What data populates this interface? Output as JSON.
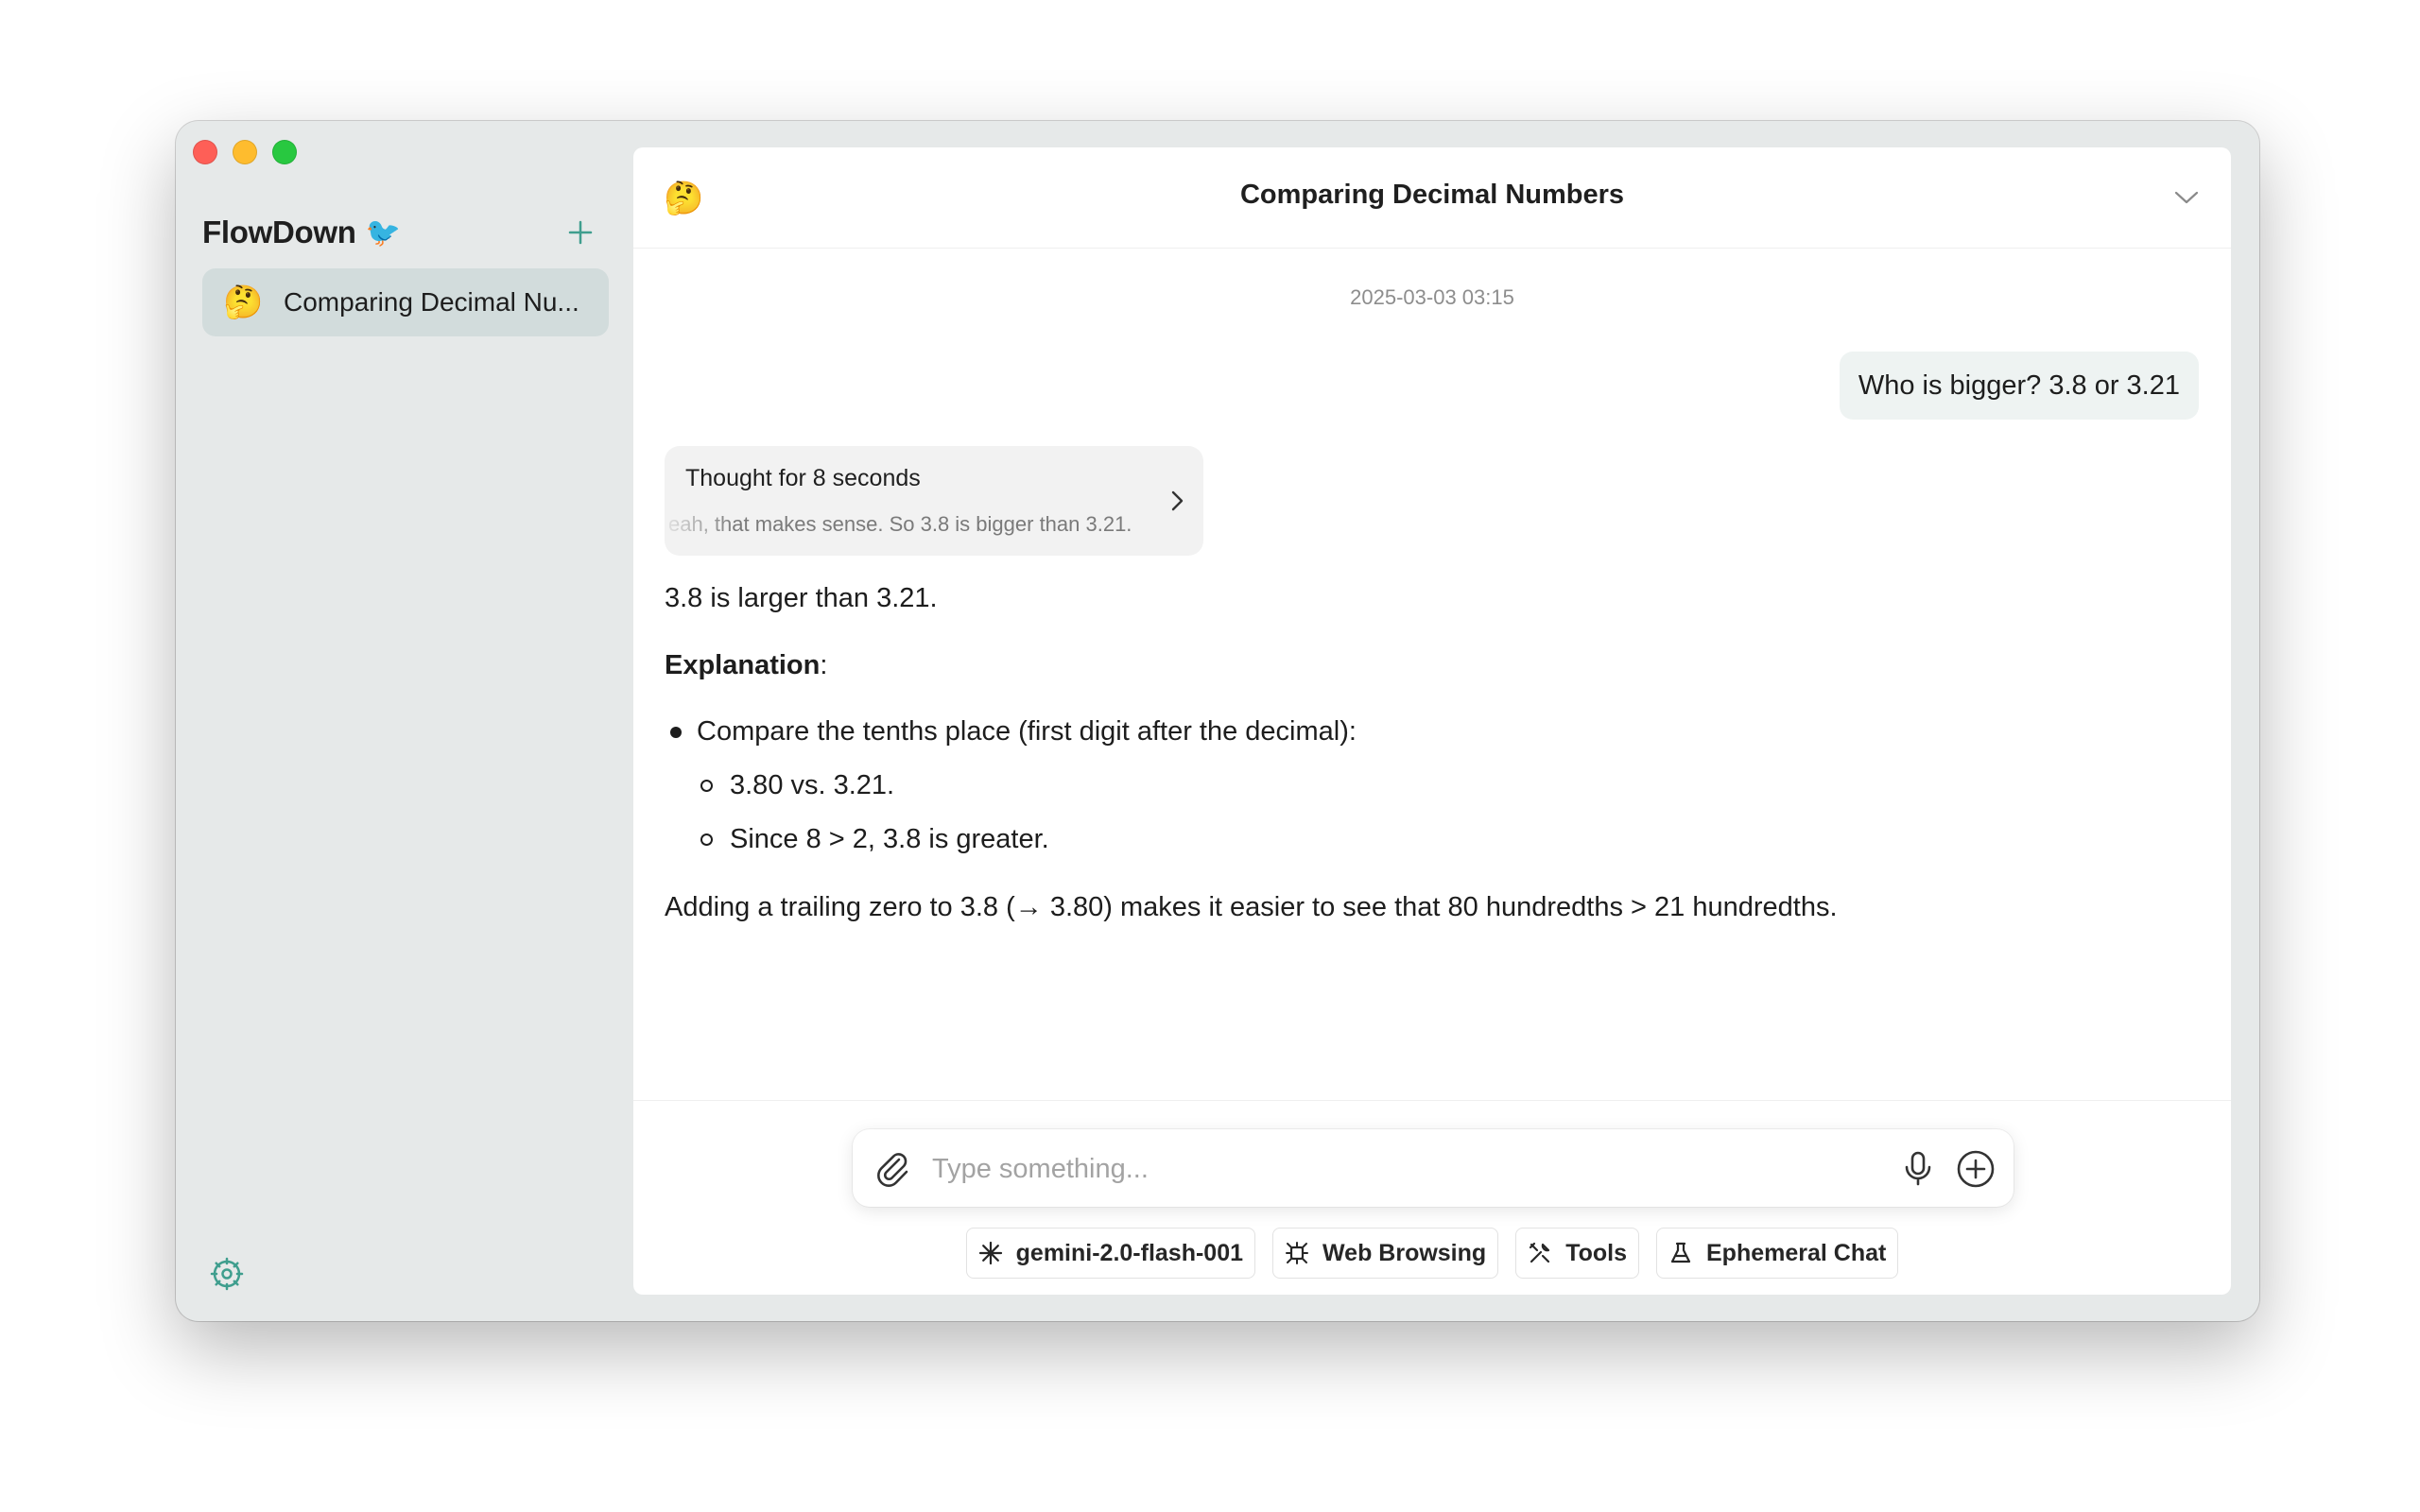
{
  "app": {
    "name": "FlowDown",
    "name_icon": "🐦",
    "colors": {
      "accent": "#3f9e8e",
      "sidebar_bg": "#e6e9e9",
      "selected_item_bg": "#d2dcdc",
      "user_bubble_bg": "#eef3f2",
      "traffic_red": "#fe5f57",
      "traffic_yellow": "#febc2e",
      "traffic_green": "#28c840"
    }
  },
  "sidebar": {
    "new_chat_icon": "plus-icon",
    "settings_icon": "gear-icon",
    "conversations": [
      {
        "emoji": "🤔",
        "label": "Comparing Decimal Nu..."
      }
    ]
  },
  "conversation": {
    "emoji": "🤔",
    "title": "Comparing Decimal Numbers",
    "menu_icon": "chevron-down-icon",
    "timestamp": "2025-03-03 03:15",
    "user_message": "Who is bigger? 3.8 or 3.21",
    "thought": {
      "title": "Thought for 8 seconds",
      "preview": "eah, that makes sense. So 3.8 is bigger than 3.21.",
      "icon": "chevron-right-icon"
    },
    "assistant": {
      "answer": "3.8 is larger than 3.21.",
      "explanation_heading": "Explanation",
      "explanation_colon": ":",
      "bullets": [
        {
          "text": "Compare the tenths place (first digit after the decimal):",
          "level": 1
        },
        {
          "text": "3.80 vs. 3.21.",
          "level": 2
        },
        {
          "text": "Since 8 > 2, 3.8 is greater.",
          "level": 2
        }
      ],
      "conclusion": "Adding a trailing zero to 3.8 (→ 3.80) makes it easier to see that 80 hundredths > 21 hundredths."
    }
  },
  "composer": {
    "placeholder": "Type something...",
    "value": "",
    "attach_icon": "paperclip-icon",
    "mic_icon": "microphone-icon",
    "add_icon": "plus-circle-icon",
    "chips": [
      {
        "label": "gemini-2.0-flash-001",
        "icon": "sparkle-icon"
      },
      {
        "label": "Web Browsing",
        "icon": "network-icon"
      },
      {
        "label": "Tools",
        "icon": "tools-icon"
      },
      {
        "label": "Ephemeral Chat",
        "icon": "flask-icon"
      }
    ]
  }
}
